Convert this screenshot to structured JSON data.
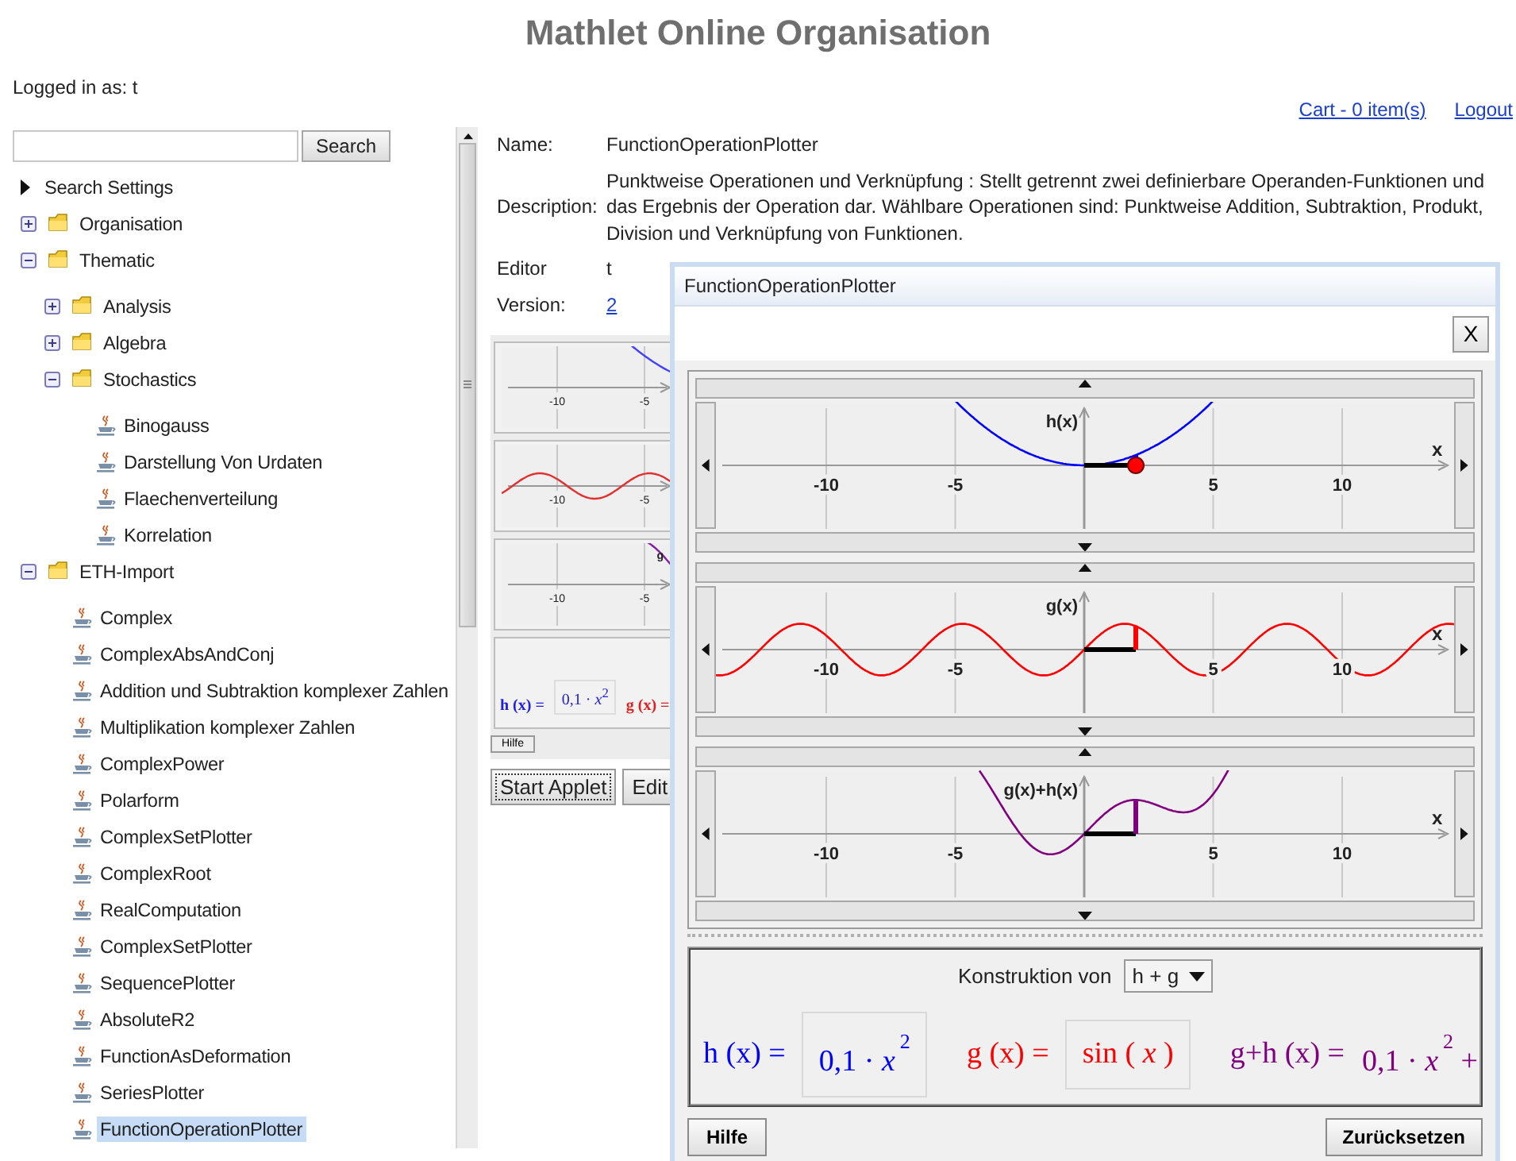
{
  "header": {
    "title": "Mathlet Online Organisation"
  },
  "user_bar": {
    "logged_in": "Logged in as: t",
    "links": [
      "Cart - 0 item(s)",
      "Logout"
    ]
  },
  "sidebar": {
    "search": {
      "button": "Search"
    },
    "search_settings": "Search Settings",
    "tree": [
      {
        "label": "Organisation",
        "kind": "folder",
        "expanded": false,
        "selected": false
      },
      {
        "label": "Thematic",
        "kind": "folder",
        "expanded": true,
        "selected": false,
        "children": [
          {
            "label": "Analysis",
            "kind": "folder",
            "expanded": false,
            "selected": false
          },
          {
            "label": "Algebra",
            "kind": "folder",
            "expanded": false,
            "selected": false
          },
          {
            "label": "Stochastics",
            "kind": "folder",
            "expanded": true,
            "selected": false,
            "children": [
              {
                "label": "Binogauss",
                "kind": "applet",
                "selected": false
              },
              {
                "label": "Darstellung Von Urdaten",
                "kind": "applet",
                "selected": false
              },
              {
                "label": "Flaechenverteilung",
                "kind": "applet",
                "selected": false
              },
              {
                "label": "Korrelation",
                "kind": "applet",
                "selected": false
              }
            ]
          }
        ]
      },
      {
        "label": "ETH-Import",
        "kind": "folder",
        "expanded": true,
        "selected": false,
        "children": [
          {
            "label": "Complex",
            "kind": "applet",
            "selected": false
          },
          {
            "label": "ComplexAbsAndConj",
            "kind": "applet",
            "selected": false
          },
          {
            "label": "Addition und Subtraktion komplexer Zahlen",
            "kind": "applet",
            "selected": false
          },
          {
            "label": "Multiplikation komplexer Zahlen",
            "kind": "applet",
            "selected": false
          },
          {
            "label": "ComplexPower",
            "kind": "applet",
            "selected": false
          },
          {
            "label": "Polarform",
            "kind": "applet",
            "selected": false
          },
          {
            "label": "ComplexSetPlotter",
            "kind": "applet",
            "selected": false
          },
          {
            "label": "ComplexRoot",
            "kind": "applet",
            "selected": false
          },
          {
            "label": "RealComputation",
            "kind": "applet",
            "selected": false
          },
          {
            "label": "ComplexSetPlotter",
            "kind": "applet",
            "selected": false
          },
          {
            "label": "SequencePlotter",
            "kind": "applet",
            "selected": false
          },
          {
            "label": "AbsoluteR2",
            "kind": "applet",
            "selected": false
          },
          {
            "label": "FunctionAsDeformation",
            "kind": "applet",
            "selected": false
          },
          {
            "label": "SeriesPlotter",
            "kind": "applet",
            "selected": false
          },
          {
            "label": "FunctionOperationPlotter",
            "kind": "applet",
            "selected": true
          }
        ]
      }
    ]
  },
  "details": {
    "rows": [
      {
        "label": "Name:",
        "value": "FunctionOperationPlotter",
        "kind": "text"
      },
      {
        "label": "Description:",
        "value": "Punktweise Operationen und Verknüpfung : Stellt getrennt zwei definierbare Operanden-Funktionen und das Ergebnis der Operation dar. Wählbare Operationen sind: Punktweise Addition, Subtraktion, Produkt, Division und Verknüpfung von Funktionen.",
        "kind": "text"
      },
      {
        "label": "Editor",
        "value": "t",
        "kind": "text"
      },
      {
        "label": "Version:",
        "value": "2",
        "kind": "link"
      }
    ]
  },
  "preview": {
    "plots": [
      {
        "kind": "parabola",
        "color": "#4040ff",
        "ticks": [
          "-10",
          "-5"
        ]
      },
      {
        "kind": "sine",
        "color": "#e03030",
        "ticks": [
          "-10",
          "-5"
        ]
      },
      {
        "kind": "sum",
        "color": "#8020a0",
        "ticks": [
          "-10",
          "-5"
        ],
        "label": "g"
      }
    ],
    "formulas": [
      {
        "label": "h (x) =",
        "expression": "0,1 · *x*$^{2}$",
        "color": "#2020e0",
        "kind": "input"
      },
      {
        "label": "g (x) =",
        "color": "#e02020",
        "kind": "label"
      }
    ],
    "help_button": "Hilfe"
  },
  "actions": [
    "Start Applet",
    "Edit"
  ],
  "dialog": {
    "title": "FunctionOperationPlotter",
    "close": "X",
    "plots": [
      {
        "kind": "parabola",
        "label": "h(x)",
        "axis_label": "x",
        "color": "#0000ff",
        "ticks": [
          "-10",
          "-5",
          "5",
          "10"
        ]
      },
      {
        "kind": "sine",
        "label": "g(x)",
        "axis_label": "x",
        "color": "#ff0000",
        "ticks": [
          "-10",
          "-5",
          "5",
          "10"
        ]
      },
      {
        "kind": "sum",
        "label": "g(x)+h(x)",
        "axis_label": "x",
        "color": "#800080",
        "ticks": [
          "-10",
          "-5",
          "5",
          "10"
        ]
      }
    ],
    "construction": {
      "label": "Konstruktion von",
      "value": "h + g"
    },
    "formulas": [
      {
        "label": "h (x) =",
        "expression": "0,1 · *x*$^{2}$",
        "color": "#0000ff",
        "kind": "input"
      },
      {
        "label": "g (x) =",
        "expression": "sin ( *x* )",
        "color": "#ff0000",
        "kind": "input"
      },
      {
        "label": "g+h (x) =",
        "expression": "0,1 · *x*$^{2}$ +",
        "color": "#800080",
        "kind": "result"
      }
    ],
    "buttons": [
      "Hilfe",
      "Zurücksetzen"
    ]
  }
}
